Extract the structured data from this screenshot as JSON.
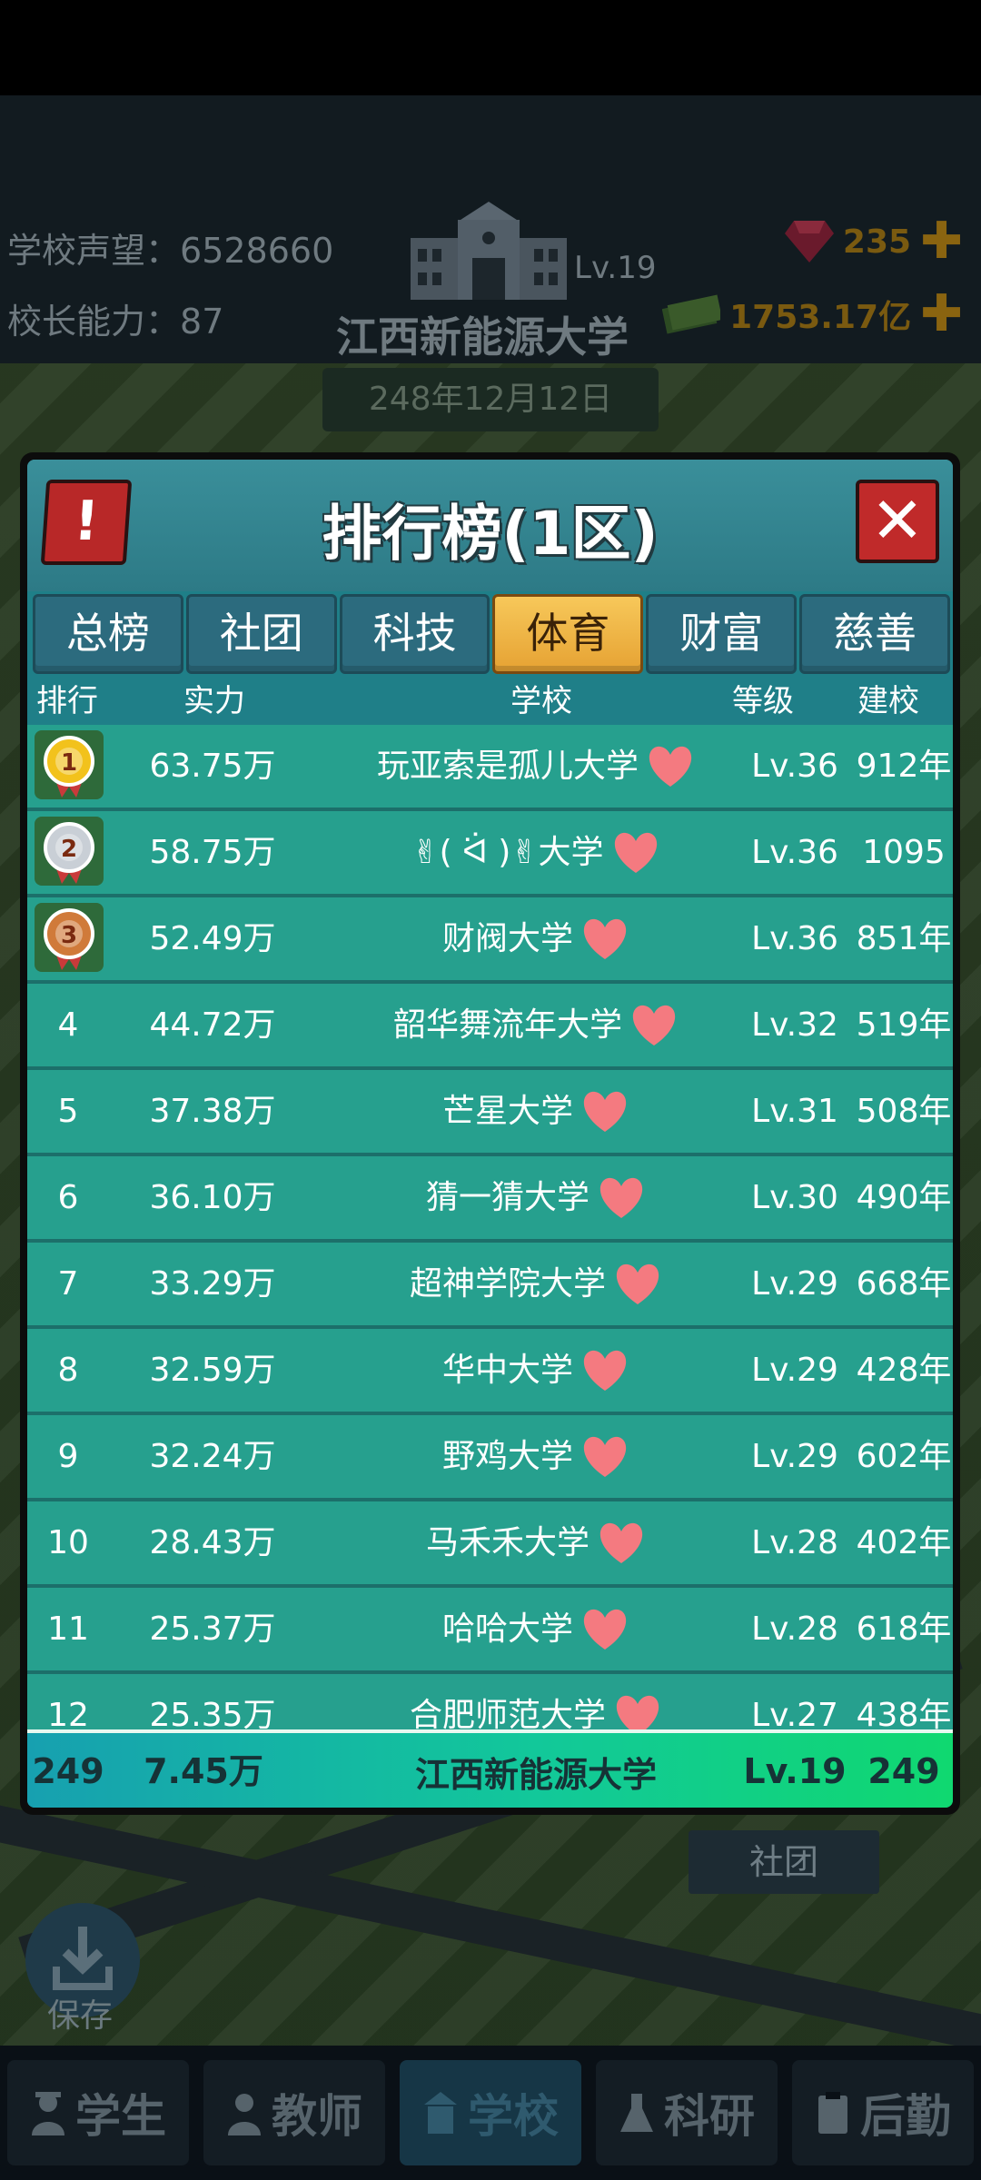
{
  "header": {
    "reputation_label": "学校声望：",
    "reputation_value": "6528660",
    "ability_label": "校长能力：",
    "ability_value": "87",
    "school_level": "Lv.19",
    "school_name": "江西新能源大学",
    "gems": "235",
    "money": "1753.17亿",
    "date": "248年12月12日"
  },
  "side": {
    "save_label": "保存",
    "club_label": "社团"
  },
  "modal": {
    "alert_symbol": "!",
    "title": "排行榜(1区)",
    "close_symbol": "✕",
    "tabs": [
      "总榜",
      "社团",
      "科技",
      "体育",
      "财富",
      "慈善"
    ],
    "active_tab": "体育",
    "columns": {
      "rank": "排行",
      "power": "实力",
      "school": "学校",
      "level": "等级",
      "founded": "建校"
    },
    "rows": [
      {
        "rank": "1",
        "power": "63.75万",
        "school": "玩亚索是孤儿大学",
        "level": "Lv.36",
        "founded": "912年"
      },
      {
        "rank": "2",
        "power": "58.75万",
        "school": "✌( ᐛ )✌大学",
        "level": "Lv.36",
        "founded": "1095年"
      },
      {
        "rank": "3",
        "power": "52.49万",
        "school": "财阀大学",
        "level": "Lv.36",
        "founded": "851年"
      },
      {
        "rank": "4",
        "power": "44.72万",
        "school": "韶华舞流年大学",
        "level": "Lv.32",
        "founded": "519年"
      },
      {
        "rank": "5",
        "power": "37.38万",
        "school": "芒星大学",
        "level": "Lv.31",
        "founded": "508年"
      },
      {
        "rank": "6",
        "power": "36.10万",
        "school": "猜一猜大学",
        "level": "Lv.30",
        "founded": "490年"
      },
      {
        "rank": "7",
        "power": "33.29万",
        "school": "超神学院大学",
        "level": "Lv.29",
        "founded": "668年"
      },
      {
        "rank": "8",
        "power": "32.59万",
        "school": "华中大学",
        "level": "Lv.29",
        "founded": "428年"
      },
      {
        "rank": "9",
        "power": "32.24万",
        "school": "野鸡大学",
        "level": "Lv.29",
        "founded": "602年"
      },
      {
        "rank": "10",
        "power": "28.43万",
        "school": "马禾禾大学",
        "level": "Lv.28",
        "founded": "402年"
      },
      {
        "rank": "11",
        "power": "25.37万",
        "school": "哈哈大学",
        "level": "Lv.28",
        "founded": "618年"
      },
      {
        "rank": "12",
        "power": "25.35万",
        "school": "合肥师范大学",
        "level": "Lv.27",
        "founded": "438年"
      }
    ],
    "my_row": {
      "rank": "249",
      "power": "7.45万",
      "school": "江西新能源大学",
      "level": "Lv.19",
      "founded": "249"
    },
    "medal_colors": [
      "#f2c21c",
      "#c9cfd6",
      "#d07a3a"
    ],
    "heart_color": "#f47a80"
  },
  "bottom_nav": [
    {
      "label": "学生",
      "icon": "student-icon"
    },
    {
      "label": "教师",
      "icon": "teacher-icon"
    },
    {
      "label": "学校",
      "icon": "school-icon"
    },
    {
      "label": "科研",
      "icon": "flask-icon"
    },
    {
      "label": "后勤",
      "icon": "clipboard-icon"
    }
  ],
  "active_nav": "学校"
}
